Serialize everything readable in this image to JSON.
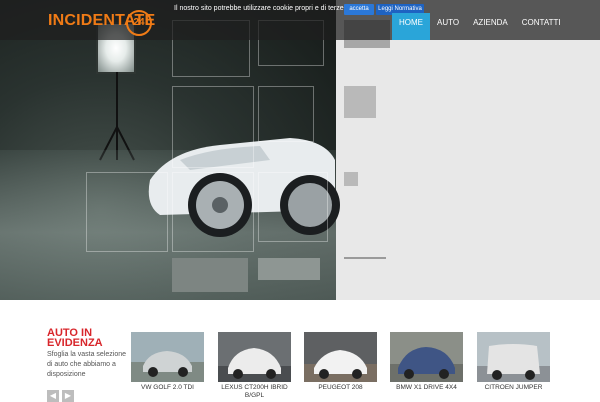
{
  "brand": {
    "logo_text": "INCIDENTATE",
    "logo_badge": "24"
  },
  "cookie_bar": {
    "message": "Il nostro sito potrebbe utilizzare cookie propri e di terze parti",
    "accept_label": "accetta",
    "policy_label": "Leggi Normativa"
  },
  "nav": {
    "items": [
      {
        "label": "HOME",
        "active": true
      },
      {
        "label": "AUTO",
        "active": false
      },
      {
        "label": "AZIENDA",
        "active": false
      },
      {
        "label": "CONTATTI",
        "active": false
      }
    ]
  },
  "featured": {
    "title": "AUTO IN EVIDENZA",
    "description": "Sfoglia la vasta selezione di auto che abbiamo a disposizione",
    "prev_icon": "chevron-left-icon",
    "next_icon": "chevron-right-icon",
    "cars": [
      {
        "name": "VW GOLF 2.0 TDI",
        "color": "#cfd3d4"
      },
      {
        "name": "LEXUS CT200H IBRID B/GPL",
        "color": "#e9e9e9"
      },
      {
        "name": "PEUGEOT 208",
        "color": "#f0f0f0"
      },
      {
        "name": "BMW X1 DRIVE 4X4",
        "color": "#3f5585"
      },
      {
        "name": "CITROEN JUMPER",
        "color": "#e2e2e2"
      }
    ]
  },
  "colors": {
    "accent_orange": "#f07b16",
    "accent_red": "#d8262b",
    "nav_active": "#2aa5d9",
    "cookie_button": "#2b78d8"
  }
}
